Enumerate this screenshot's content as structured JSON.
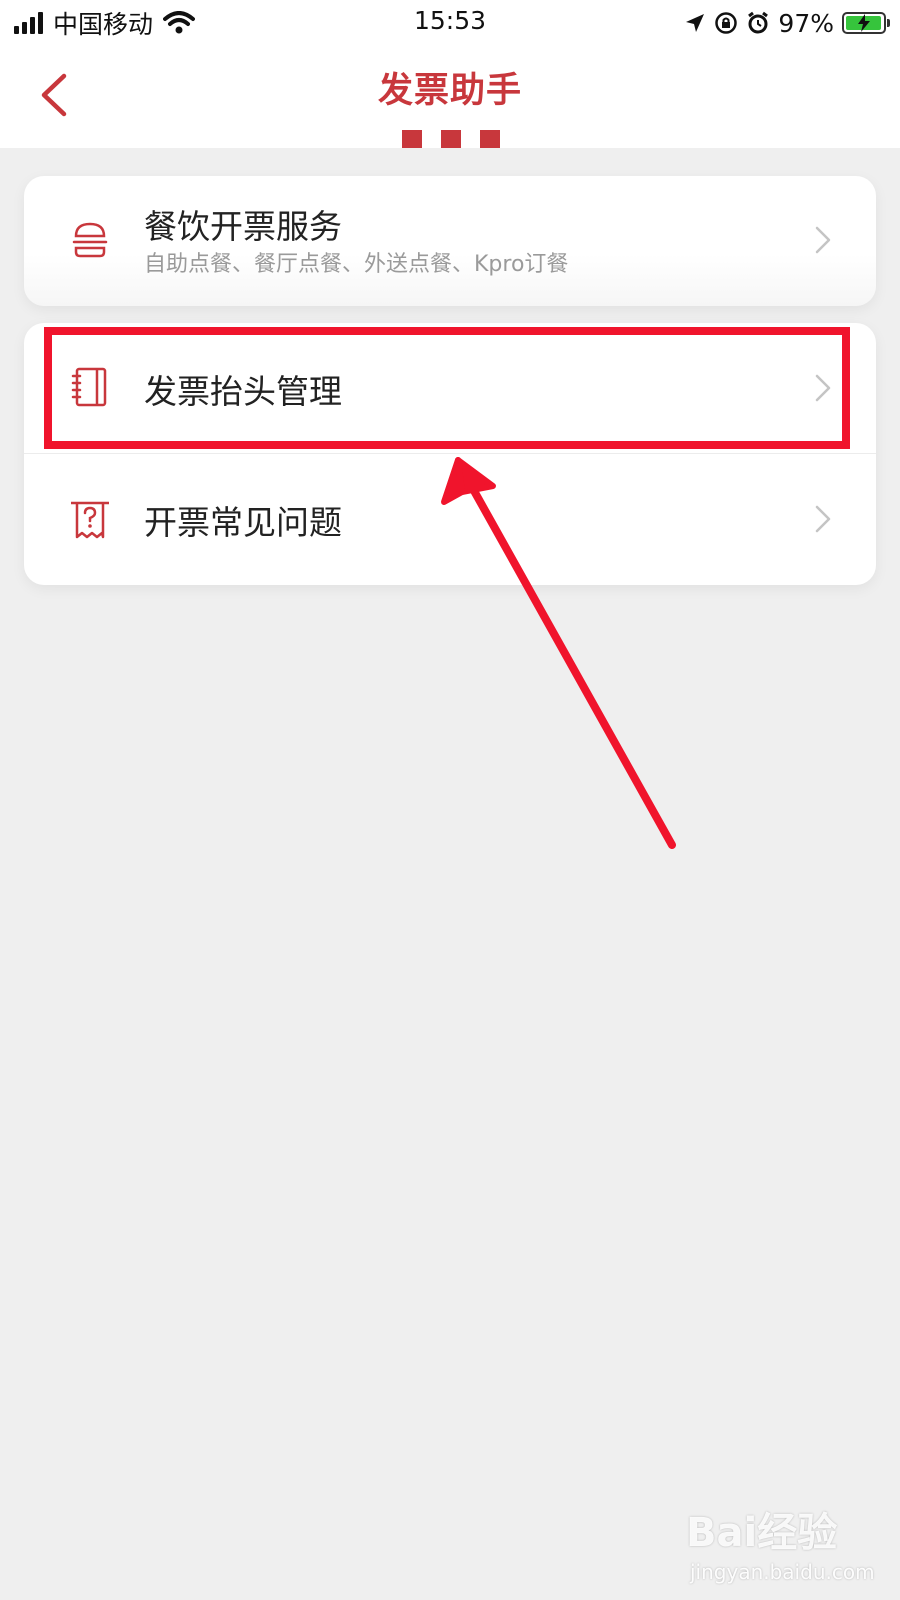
{
  "status_bar": {
    "carrier": "中国移动",
    "time": "15:53",
    "battery_percent": "97%",
    "icons": [
      "signal-icon",
      "wifi-icon",
      "location-icon",
      "orientation-lock-icon",
      "alarm-icon",
      "battery-charging-icon"
    ],
    "battery_level": 0.97
  },
  "nav": {
    "title": "发票助手",
    "back_icon": "chevron-left-icon"
  },
  "menu": {
    "cards": [
      {
        "items": [
          {
            "title": "餐饮开票服务",
            "subtitle": "自助点餐、餐厅点餐、外送点餐、Kpro订餐",
            "icon": "burger-icon"
          }
        ]
      },
      {
        "items": [
          {
            "title": "发票抬头管理",
            "icon": "notebook-icon"
          },
          {
            "title": "开票常见问题",
            "icon": "receipt-question-icon"
          }
        ]
      }
    ]
  },
  "watermark": {
    "brand": "Bai经验",
    "url": "jingyan.baidu.com"
  },
  "colors": {
    "accent": "#c8373c",
    "highlight": "#f0142c",
    "background": "#efefef",
    "card": "#ffffff"
  }
}
